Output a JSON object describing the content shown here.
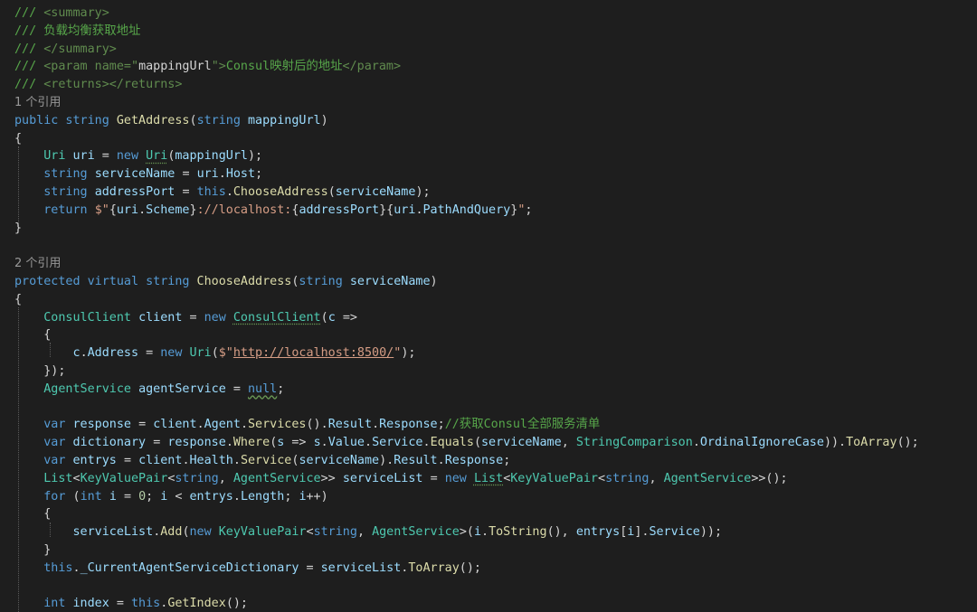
{
  "code": {
    "lines": [
      {
        "kind": "code",
        "spans": [
          {
            "t": "/// ",
            "c": "cm"
          },
          {
            "t": "<summary>",
            "c": "dg"
          }
        ]
      },
      {
        "kind": "code",
        "spans": [
          {
            "t": "/// 负载均衡获取地址",
            "c": "cm"
          }
        ]
      },
      {
        "kind": "code",
        "spans": [
          {
            "t": "/// ",
            "c": "cm"
          },
          {
            "t": "</summary>",
            "c": "dg"
          }
        ]
      },
      {
        "kind": "code",
        "spans": [
          {
            "t": "/// ",
            "c": "cm"
          },
          {
            "t": "<param name=\"",
            "c": "dg"
          },
          {
            "t": "mappingUrl",
            "c": "pl"
          },
          {
            "t": "\">",
            "c": "dg"
          },
          {
            "t": "Consul映射后的地址",
            "c": "cm"
          },
          {
            "t": "</param>",
            "c": "dg"
          }
        ]
      },
      {
        "kind": "code",
        "spans": [
          {
            "t": "/// ",
            "c": "cm"
          },
          {
            "t": "<returns></returns>",
            "c": "dg"
          }
        ]
      },
      {
        "kind": "lens",
        "text": "1 个引用"
      },
      {
        "kind": "code",
        "spans": [
          {
            "t": "public string ",
            "c": "kw"
          },
          {
            "t": "GetAddress",
            "c": "fn"
          },
          {
            "t": "(",
            "c": "pl"
          },
          {
            "t": "string ",
            "c": "kw"
          },
          {
            "t": "mappingUrl",
            "c": "id"
          },
          {
            "t": ")",
            "c": "pl"
          }
        ]
      },
      {
        "kind": "code",
        "spans": [
          {
            "t": "{",
            "c": "pl"
          }
        ]
      },
      {
        "kind": "code",
        "spans": [
          {
            "t": "    ",
            "c": "pl"
          },
          {
            "t": "Uri ",
            "c": "ty"
          },
          {
            "t": "uri ",
            "c": "id"
          },
          {
            "t": "= ",
            "c": "pl"
          },
          {
            "t": "new ",
            "c": "kw"
          },
          {
            "t": "Uri",
            "c": "ty",
            "u": "squig"
          },
          {
            "t": "(",
            "c": "pl"
          },
          {
            "t": "mappingUrl",
            "c": "id"
          },
          {
            "t": ");",
            "c": "pl"
          }
        ]
      },
      {
        "kind": "code",
        "spans": [
          {
            "t": "    ",
            "c": "pl"
          },
          {
            "t": "string ",
            "c": "kw"
          },
          {
            "t": "serviceName ",
            "c": "id"
          },
          {
            "t": "= ",
            "c": "pl"
          },
          {
            "t": "uri",
            "c": "id"
          },
          {
            "t": ".",
            "c": "pl"
          },
          {
            "t": "Host",
            "c": "id"
          },
          {
            "t": ";",
            "c": "pl"
          }
        ]
      },
      {
        "kind": "code",
        "spans": [
          {
            "t": "    ",
            "c": "pl"
          },
          {
            "t": "string ",
            "c": "kw"
          },
          {
            "t": "addressPort ",
            "c": "id"
          },
          {
            "t": "= ",
            "c": "pl"
          },
          {
            "t": "this",
            "c": "kw"
          },
          {
            "t": ".",
            "c": "pl"
          },
          {
            "t": "ChooseAddress",
            "c": "fn"
          },
          {
            "t": "(",
            "c": "pl"
          },
          {
            "t": "serviceName",
            "c": "id"
          },
          {
            "t": ");",
            "c": "pl"
          }
        ]
      },
      {
        "kind": "code",
        "spans": [
          {
            "t": "    ",
            "c": "pl"
          },
          {
            "t": "return ",
            "c": "kw"
          },
          {
            "t": "$\"",
            "c": "st"
          },
          {
            "t": "{",
            "c": "pl"
          },
          {
            "t": "uri",
            "c": "id"
          },
          {
            "t": ".",
            "c": "pl"
          },
          {
            "t": "Scheme",
            "c": "id"
          },
          {
            "t": "}",
            "c": "pl"
          },
          {
            "t": "://localhost:",
            "c": "st"
          },
          {
            "t": "{",
            "c": "pl"
          },
          {
            "t": "addressPort",
            "c": "id"
          },
          {
            "t": "}{",
            "c": "pl"
          },
          {
            "t": "uri",
            "c": "id"
          },
          {
            "t": ".",
            "c": "pl"
          },
          {
            "t": "PathAndQuery",
            "c": "id"
          },
          {
            "t": "}",
            "c": "pl"
          },
          {
            "t": "\"",
            "c": "st"
          },
          {
            "t": ";",
            "c": "pl"
          }
        ]
      },
      {
        "kind": "code",
        "spans": [
          {
            "t": "}",
            "c": "pl"
          }
        ]
      },
      {
        "kind": "code",
        "spans": []
      },
      {
        "kind": "lens",
        "text": "2 个引用"
      },
      {
        "kind": "code",
        "spans": [
          {
            "t": "protected virtual string ",
            "c": "kw"
          },
          {
            "t": "ChooseAddress",
            "c": "fn"
          },
          {
            "t": "(",
            "c": "pl"
          },
          {
            "t": "string ",
            "c": "kw"
          },
          {
            "t": "serviceName",
            "c": "id"
          },
          {
            "t": ")",
            "c": "pl"
          }
        ]
      },
      {
        "kind": "code",
        "spans": [
          {
            "t": "{",
            "c": "pl"
          }
        ]
      },
      {
        "kind": "code",
        "spans": [
          {
            "t": "    ",
            "c": "pl"
          },
          {
            "t": "ConsulClient ",
            "c": "ty"
          },
          {
            "t": "client ",
            "c": "id"
          },
          {
            "t": "= ",
            "c": "pl"
          },
          {
            "t": "new ",
            "c": "kw"
          },
          {
            "t": "ConsulClient",
            "c": "ty",
            "u": "squig"
          },
          {
            "t": "(",
            "c": "pl"
          },
          {
            "t": "c ",
            "c": "id"
          },
          {
            "t": "=>",
            "c": "pl"
          }
        ]
      },
      {
        "kind": "code",
        "spans": [
          {
            "t": "    {",
            "c": "pl"
          }
        ]
      },
      {
        "kind": "code",
        "spans": [
          {
            "t": "        ",
            "c": "pl"
          },
          {
            "t": "c",
            "c": "id"
          },
          {
            "t": ".",
            "c": "pl"
          },
          {
            "t": "Address ",
            "c": "id"
          },
          {
            "t": "= ",
            "c": "pl"
          },
          {
            "t": "new ",
            "c": "kw"
          },
          {
            "t": "Uri",
            "c": "ty"
          },
          {
            "t": "(",
            "c": "pl"
          },
          {
            "t": "$\"",
            "c": "st"
          },
          {
            "t": "http://localhost:8500/",
            "c": "url"
          },
          {
            "t": "\"",
            "c": "st"
          },
          {
            "t": ");",
            "c": "pl"
          }
        ]
      },
      {
        "kind": "code",
        "spans": [
          {
            "t": "    });",
            "c": "pl"
          }
        ]
      },
      {
        "kind": "code",
        "spans": [
          {
            "t": "    ",
            "c": "pl"
          },
          {
            "t": "AgentService ",
            "c": "ty"
          },
          {
            "t": "agentService ",
            "c": "id"
          },
          {
            "t": "= ",
            "c": "pl"
          },
          {
            "t": "null",
            "c": "kw",
            "u": "wavy"
          },
          {
            "t": ";",
            "c": "pl"
          }
        ]
      },
      {
        "kind": "code",
        "spans": []
      },
      {
        "kind": "code",
        "spans": [
          {
            "t": "    ",
            "c": "pl"
          },
          {
            "t": "var ",
            "c": "kw"
          },
          {
            "t": "response ",
            "c": "id"
          },
          {
            "t": "= ",
            "c": "pl"
          },
          {
            "t": "client",
            "c": "id"
          },
          {
            "t": ".",
            "c": "pl"
          },
          {
            "t": "Agent",
            "c": "id"
          },
          {
            "t": ".",
            "c": "pl"
          },
          {
            "t": "Services",
            "c": "fn"
          },
          {
            "t": "().",
            "c": "pl"
          },
          {
            "t": "Result",
            "c": "id"
          },
          {
            "t": ".",
            "c": "pl"
          },
          {
            "t": "Response",
            "c": "id"
          },
          {
            "t": ";",
            "c": "pl"
          },
          {
            "t": "//获取Consul全部服务清单",
            "c": "cm"
          }
        ]
      },
      {
        "kind": "code",
        "spans": [
          {
            "t": "    ",
            "c": "pl"
          },
          {
            "t": "var ",
            "c": "kw"
          },
          {
            "t": "dictionary ",
            "c": "id"
          },
          {
            "t": "= ",
            "c": "pl"
          },
          {
            "t": "response",
            "c": "id"
          },
          {
            "t": ".",
            "c": "pl"
          },
          {
            "t": "Where",
            "c": "fn"
          },
          {
            "t": "(",
            "c": "pl"
          },
          {
            "t": "s ",
            "c": "id"
          },
          {
            "t": "=> ",
            "c": "pl"
          },
          {
            "t": "s",
            "c": "id"
          },
          {
            "t": ".",
            "c": "pl"
          },
          {
            "t": "Value",
            "c": "id"
          },
          {
            "t": ".",
            "c": "pl"
          },
          {
            "t": "Service",
            "c": "id"
          },
          {
            "t": ".",
            "c": "pl"
          },
          {
            "t": "Equals",
            "c": "fn"
          },
          {
            "t": "(",
            "c": "pl"
          },
          {
            "t": "serviceName",
            "c": "id"
          },
          {
            "t": ", ",
            "c": "pl"
          },
          {
            "t": "StringComparison",
            "c": "ty"
          },
          {
            "t": ".",
            "c": "pl"
          },
          {
            "t": "OrdinalIgnoreCase",
            "c": "id"
          },
          {
            "t": ")).",
            "c": "pl"
          },
          {
            "t": "ToArray",
            "c": "fn"
          },
          {
            "t": "();",
            "c": "pl"
          }
        ]
      },
      {
        "kind": "code",
        "spans": [
          {
            "t": "    ",
            "c": "pl"
          },
          {
            "t": "var ",
            "c": "kw"
          },
          {
            "t": "entrys ",
            "c": "id"
          },
          {
            "t": "= ",
            "c": "pl"
          },
          {
            "t": "client",
            "c": "id"
          },
          {
            "t": ".",
            "c": "pl"
          },
          {
            "t": "Health",
            "c": "id"
          },
          {
            "t": ".",
            "c": "pl"
          },
          {
            "t": "Service",
            "c": "fn"
          },
          {
            "t": "(",
            "c": "pl"
          },
          {
            "t": "serviceName",
            "c": "id"
          },
          {
            "t": ").",
            "c": "pl"
          },
          {
            "t": "Result",
            "c": "id"
          },
          {
            "t": ".",
            "c": "pl"
          },
          {
            "t": "Response",
            "c": "id"
          },
          {
            "t": ";",
            "c": "pl"
          }
        ]
      },
      {
        "kind": "code",
        "spans": [
          {
            "t": "    ",
            "c": "pl"
          },
          {
            "t": "List",
            "c": "ty"
          },
          {
            "t": "<",
            "c": "pl"
          },
          {
            "t": "KeyValuePair",
            "c": "ty"
          },
          {
            "t": "<",
            "c": "pl"
          },
          {
            "t": "string",
            "c": "kw"
          },
          {
            "t": ", ",
            "c": "pl"
          },
          {
            "t": "AgentService",
            "c": "ty"
          },
          {
            "t": ">> ",
            "c": "pl"
          },
          {
            "t": "serviceList ",
            "c": "id"
          },
          {
            "t": "= ",
            "c": "pl"
          },
          {
            "t": "new ",
            "c": "kw"
          },
          {
            "t": "List",
            "c": "ty",
            "u": "squig"
          },
          {
            "t": "<",
            "c": "pl"
          },
          {
            "t": "KeyValuePair",
            "c": "ty"
          },
          {
            "t": "<",
            "c": "pl"
          },
          {
            "t": "string",
            "c": "kw"
          },
          {
            "t": ", ",
            "c": "pl"
          },
          {
            "t": "AgentService",
            "c": "ty"
          },
          {
            "t": ">>();",
            "c": "pl"
          }
        ]
      },
      {
        "kind": "code",
        "spans": [
          {
            "t": "    ",
            "c": "pl"
          },
          {
            "t": "for ",
            "c": "kw"
          },
          {
            "t": "(",
            "c": "pl"
          },
          {
            "t": "int ",
            "c": "kw"
          },
          {
            "t": "i ",
            "c": "id"
          },
          {
            "t": "= ",
            "c": "pl"
          },
          {
            "t": "0",
            "c": "nm"
          },
          {
            "t": "; ",
            "c": "pl"
          },
          {
            "t": "i ",
            "c": "id"
          },
          {
            "t": "< ",
            "c": "pl"
          },
          {
            "t": "entrys",
            "c": "id"
          },
          {
            "t": ".",
            "c": "pl"
          },
          {
            "t": "Length",
            "c": "id"
          },
          {
            "t": "; ",
            "c": "pl"
          },
          {
            "t": "i",
            "c": "id"
          },
          {
            "t": "++)",
            "c": "pl"
          }
        ]
      },
      {
        "kind": "code",
        "spans": [
          {
            "t": "    {",
            "c": "pl"
          }
        ]
      },
      {
        "kind": "code",
        "spans": [
          {
            "t": "        ",
            "c": "pl"
          },
          {
            "t": "serviceList",
            "c": "id"
          },
          {
            "t": ".",
            "c": "pl"
          },
          {
            "t": "Add",
            "c": "fn"
          },
          {
            "t": "(",
            "c": "pl"
          },
          {
            "t": "new ",
            "c": "kw"
          },
          {
            "t": "KeyValuePair",
            "c": "ty"
          },
          {
            "t": "<",
            "c": "pl"
          },
          {
            "t": "string",
            "c": "kw"
          },
          {
            "t": ", ",
            "c": "pl"
          },
          {
            "t": "AgentService",
            "c": "ty"
          },
          {
            "t": ">(",
            "c": "pl"
          },
          {
            "t": "i",
            "c": "id"
          },
          {
            "t": ".",
            "c": "pl"
          },
          {
            "t": "ToString",
            "c": "fn"
          },
          {
            "t": "(), ",
            "c": "pl"
          },
          {
            "t": "entrys",
            "c": "id"
          },
          {
            "t": "[",
            "c": "pl"
          },
          {
            "t": "i",
            "c": "id"
          },
          {
            "t": "].",
            "c": "pl"
          },
          {
            "t": "Service",
            "c": "id"
          },
          {
            "t": "));",
            "c": "pl"
          }
        ]
      },
      {
        "kind": "code",
        "spans": [
          {
            "t": "    }",
            "c": "pl"
          }
        ]
      },
      {
        "kind": "code",
        "spans": [
          {
            "t": "    ",
            "c": "pl"
          },
          {
            "t": "this",
            "c": "kw"
          },
          {
            "t": ".",
            "c": "pl"
          },
          {
            "t": "_CurrentAgentServiceDictionary ",
            "c": "id"
          },
          {
            "t": "= ",
            "c": "pl"
          },
          {
            "t": "serviceList",
            "c": "id"
          },
          {
            "t": ".",
            "c": "pl"
          },
          {
            "t": "ToArray",
            "c": "fn"
          },
          {
            "t": "();",
            "c": "pl"
          }
        ]
      },
      {
        "kind": "code",
        "spans": []
      },
      {
        "kind": "code",
        "spans": [
          {
            "t": "    ",
            "c": "pl"
          },
          {
            "t": "int ",
            "c": "kw"
          },
          {
            "t": "index ",
            "c": "id"
          },
          {
            "t": "= ",
            "c": "pl"
          },
          {
            "t": "this",
            "c": "kw"
          },
          {
            "t": ".",
            "c": "pl"
          },
          {
            "t": "GetIndex",
            "c": "fn"
          },
          {
            "t": "();",
            "c": "pl"
          }
        ]
      }
    ]
  }
}
